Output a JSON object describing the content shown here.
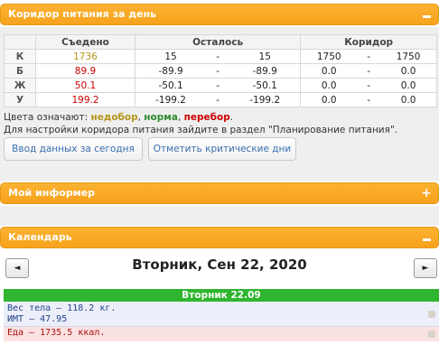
{
  "panels": {
    "corridor": {
      "title": "Коридор питания за день"
    },
    "informer": {
      "title": "Мой информер"
    },
    "calendar": {
      "title": "Календарь"
    }
  },
  "corridor_table": {
    "headers": {
      "eaten": "Съедено",
      "remaining": "Осталось",
      "corridor": "Коридор"
    },
    "rows": [
      {
        "label": "К",
        "eaten": "1736",
        "rem_a": "15",
        "rem_sep": "-",
        "rem_b": "15",
        "cor_a": "1750",
        "cor_sep": "-",
        "cor_b": "1750"
      },
      {
        "label": "Б",
        "eaten": "89.9",
        "rem_a": "-89.9",
        "rem_sep": "-",
        "rem_b": "-89.9",
        "cor_a": "0.0",
        "cor_sep": "-",
        "cor_b": "0.0"
      },
      {
        "label": "Ж",
        "eaten": "50.1",
        "rem_a": "-50.1",
        "rem_sep": "-",
        "rem_b": "-50.1",
        "cor_a": "0.0",
        "cor_sep": "-",
        "cor_b": "0.0"
      },
      {
        "label": "У",
        "eaten": "199.2",
        "rem_a": "-199.2",
        "rem_sep": "-",
        "rem_b": "-199.2",
        "cor_a": "0.0",
        "cor_sep": "-",
        "cor_b": "0.0"
      }
    ]
  },
  "legend": {
    "prefix": "Цвета означают: ",
    "under": "недобор",
    "sep1": ", ",
    "norm": "норма",
    "sep2": ", ",
    "over": "перебор",
    "suffix": "."
  },
  "settings_note": "Для настройки коридора питания зайдите в раздел \"Планирование питания\".",
  "buttons": {
    "enter_today": "Ввод данных за сегодня",
    "critical_days": "Отметить критические дни"
  },
  "calendar": {
    "prev": "◄",
    "next": "►",
    "date_title": "Вторник, Сен 22, 2020",
    "day_header": "Вторник 22.09",
    "weight": "Вес тела — 118.2 кг.",
    "bmi": "ИМТ — 47.95",
    "food": "Еда — 1735.5 ккал."
  },
  "colors": {
    "header_orange": "#f7a21c",
    "under": "#b5951a",
    "norm": "#2e8b2e",
    "over": "#cc0000",
    "day_green": "#2fb52f"
  }
}
